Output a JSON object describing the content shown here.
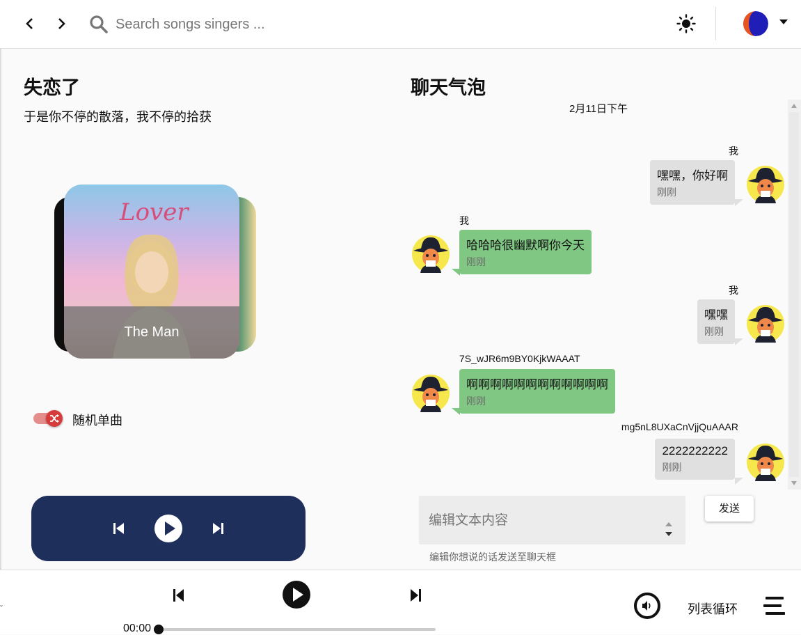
{
  "topbar": {
    "search_placeholder": "Search songs singers ...",
    "back_icon": "chevron-left-icon",
    "forward_icon": "chevron-right-icon",
    "search_icon": "search-icon",
    "theme_icon": "sun-icon",
    "dropdown_icon": "caret-down-icon"
  },
  "left": {
    "title": "失恋了",
    "subtitle": "于是你不停的散落，我不停的拾获",
    "cover_caption": "The Man",
    "cover_art_text": "Lover",
    "shuffle_label": "随机单曲",
    "shuffle_on": true
  },
  "chat": {
    "title": "聊天气泡",
    "date": "2月11日下午",
    "messages": [
      {
        "name": "我",
        "text": "嘿嘿，你好啊",
        "time": "刚刚",
        "side": "right"
      },
      {
        "name": "我",
        "text": "哈哈哈很幽默啊你今天",
        "time": "刚刚",
        "side": "left"
      },
      {
        "name": "我",
        "text": "嘿嘿",
        "time": "刚刚",
        "side": "right"
      },
      {
        "name": "7S_wJR6m9BY0KjkWAAAT",
        "text": "啊啊啊啊啊啊啊啊啊啊啊啊",
        "time": "刚刚",
        "side": "left"
      },
      {
        "name": "mg5nL8UXaCnVjjQuAAAR",
        "text": "2222222222",
        "time": "刚刚",
        "side": "right"
      }
    ],
    "input_placeholder": "编辑文本内容",
    "input_hint": "编辑你想说的话发送至聊天框",
    "send_label": "发送"
  },
  "player": {
    "current_time": "00:00",
    "progress": 0,
    "loop_mode": "列表循环",
    "volume_icon": "volume-icon",
    "playlist_icon": "playlist-icon",
    "edge_mark": "ˇ"
  },
  "colors": {
    "mini_player_bg": "#1f2f5c",
    "bubble_green": "#81c784",
    "bubble_gray": "#e0e0e0",
    "shuffle_accent": "#d63b3b"
  }
}
